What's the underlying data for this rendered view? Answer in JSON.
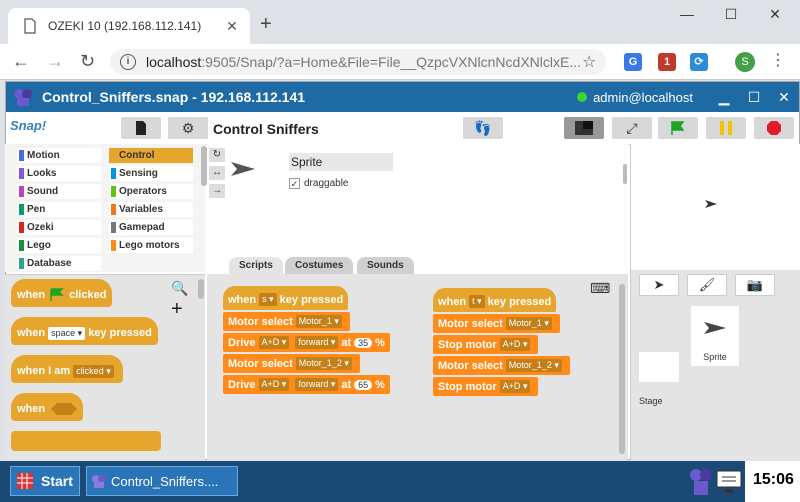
{
  "browser": {
    "tab_title": "OZEKI 10 (192.168.112.141)",
    "tab_close": "✕",
    "new_tab": "+",
    "minimize": "—",
    "maximize": "☐",
    "close": "✕",
    "url_host": "localhost",
    "url_rest": ":9505/Snap/?a=Home&File=File__QzpcVXNlcnNcdXNlclxE...",
    "star": "☆",
    "ext_badge": "1",
    "profile_letter": "S",
    "menu": "⋮"
  },
  "app": {
    "title": "Control_Sniffers.snap - 192.168.112.141",
    "user": "admin@localhost",
    "min": "▁",
    "max": "☐",
    "close": "✕"
  },
  "snap": {
    "logo": "Snap!",
    "project_title": "Control  Sniffers",
    "categories": [
      {
        "label": "Motion",
        "color": "#4a6cd4"
      },
      {
        "label": "Control",
        "color": "#e6a52c"
      },
      {
        "label": "Looks",
        "color": "#8a55d7"
      },
      {
        "label": "Sensing",
        "color": "#0094dd"
      },
      {
        "label": "Sound",
        "color": "#bb42c3"
      },
      {
        "label": "Operators",
        "color": "#62c213"
      },
      {
        "label": "Pen",
        "color": "#0e9a6c"
      },
      {
        "label": "Variables",
        "color": "#f3761d"
      },
      {
        "label": "Ozeki",
        "color": "#d8241f"
      },
      {
        "label": "Gamepad",
        "color": "#777777"
      },
      {
        "label": "Lego",
        "color": "#1a8f3a"
      },
      {
        "label": "Lego motors",
        "color": "#ff8c1a"
      },
      {
        "label": "Database",
        "color": "#2ca58d"
      }
    ],
    "palette": {
      "when": "when",
      "clicked": "clicked",
      "key_pressed": "key pressed",
      "space": "space",
      "when_i_am": "when I am",
      "clicked_opt": "clicked"
    },
    "sprite": {
      "name": "Sprite",
      "draggable": "draggable",
      "check": "✓"
    },
    "tabs": [
      "Scripts",
      "Costumes",
      "Sounds"
    ],
    "script1": {
      "when": "when",
      "key": "s",
      "key_pressed": "key pressed",
      "motor_select": "Motor select",
      "motor1": "Motor_1",
      "drive": "Drive",
      "ad": "A+D",
      "forward": "forward",
      "at": "at",
      "speed1": "35",
      "pct": "%",
      "motor12": "Motor_1_2",
      "speed2": "65"
    },
    "script2": {
      "when": "when",
      "key": "t",
      "key_pressed": "key pressed",
      "motor_select": "Motor select",
      "motor1": "Motor_1",
      "stop_motor": "Stop motor",
      "ad": "A+D",
      "motor12": "Motor_1_2"
    },
    "corral": {
      "sprite_label": "Sprite",
      "stage_label": "Stage"
    }
  },
  "taskbar": {
    "start": "Start",
    "task": "Control_Sniffers....",
    "clock": "15:06"
  }
}
